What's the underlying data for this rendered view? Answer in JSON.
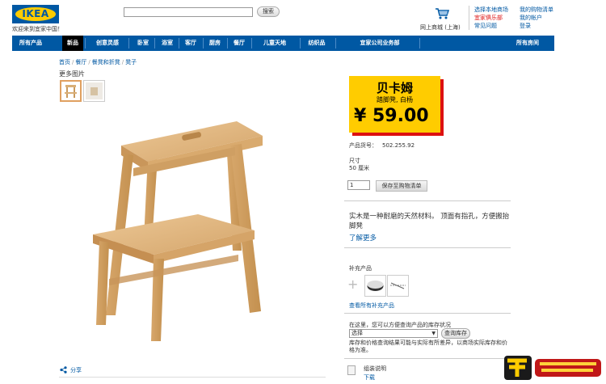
{
  "header": {
    "logo_text": "IKEA",
    "welcome": "欢迎来到宜家中国！",
    "search_button": "搜索",
    "search_placeholder": "",
    "cart_label": "网上商城 (上海)",
    "links_col1": [
      "选择本地商场",
      "宜家俱乐部",
      "常见问题"
    ],
    "links_col2": [
      "我的购物清单",
      "我的帐户",
      "登录"
    ]
  },
  "nav": {
    "items": [
      "所有产品",
      "新品",
      "创意灵感",
      "卧室",
      "浴室",
      "客厅",
      "厨房",
      "餐厅",
      "儿童天地",
      "纺织品",
      "宜家公司业务部",
      "所有房间"
    ]
  },
  "breadcrumb": [
    "首页",
    "餐厅",
    "餐凳和折凳",
    "凳子"
  ],
  "gallery": {
    "more_label": "更多图片"
  },
  "product": {
    "name": "贝卡姆",
    "subtitle": "踏脚凳, 白杨",
    "price": "¥ 59.00",
    "number_label": "产品货号：",
    "number": "502.255.92",
    "size_label": "尺寸",
    "size_value": "50 厘米",
    "qty": "1",
    "save_button": "保存至购物清单",
    "description": "实木是一种耐磨的天然材料。 顶面有指孔，方便搬抬脚凳",
    "learn_more": "了解更多"
  },
  "accessories": {
    "title": "补充产品",
    "link": "查看所有补充产品"
  },
  "stock": {
    "title": "在这里，您可以方便查询产品的库存状况",
    "select_value": "选择",
    "button": "查询库存",
    "note": "库存和价格查询结果可能与实际有所差异，以商场实际库存和价格为准。"
  },
  "docs": {
    "title": "组装说明",
    "link": "下载"
  },
  "share_label": "分享",
  "colors": {
    "brand_blue": "#0058a3",
    "brand_yellow": "#ffcc00",
    "price_shadow": "#dd1111"
  }
}
